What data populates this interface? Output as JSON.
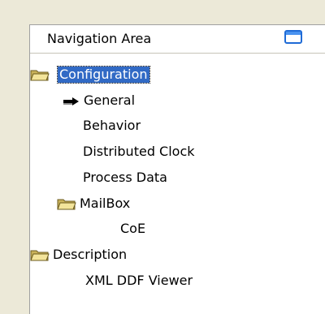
{
  "panel": {
    "title": "Navigation Area",
    "restore_icon": "window-restore-icon"
  },
  "colors": {
    "selection": "#316ac5",
    "folder": "#e8d27a",
    "icon_blue": "#1f6bd6"
  },
  "tree": {
    "configuration": {
      "label": "Configuration",
      "icon": "open-folder-icon",
      "selected": true
    },
    "general": {
      "label": "General",
      "icon": "arrow-right-icon"
    },
    "behavior": {
      "label": "Behavior"
    },
    "distributed_clock": {
      "label": "Distributed Clock"
    },
    "process_data": {
      "label": "Process Data"
    },
    "mailbox": {
      "label": "MailBox",
      "icon": "open-folder-icon"
    },
    "coe": {
      "label": "CoE"
    },
    "description": {
      "label": "Description",
      "icon": "open-folder-icon"
    },
    "xml_ddf_viewer": {
      "label": "XML DDF Viewer"
    }
  }
}
